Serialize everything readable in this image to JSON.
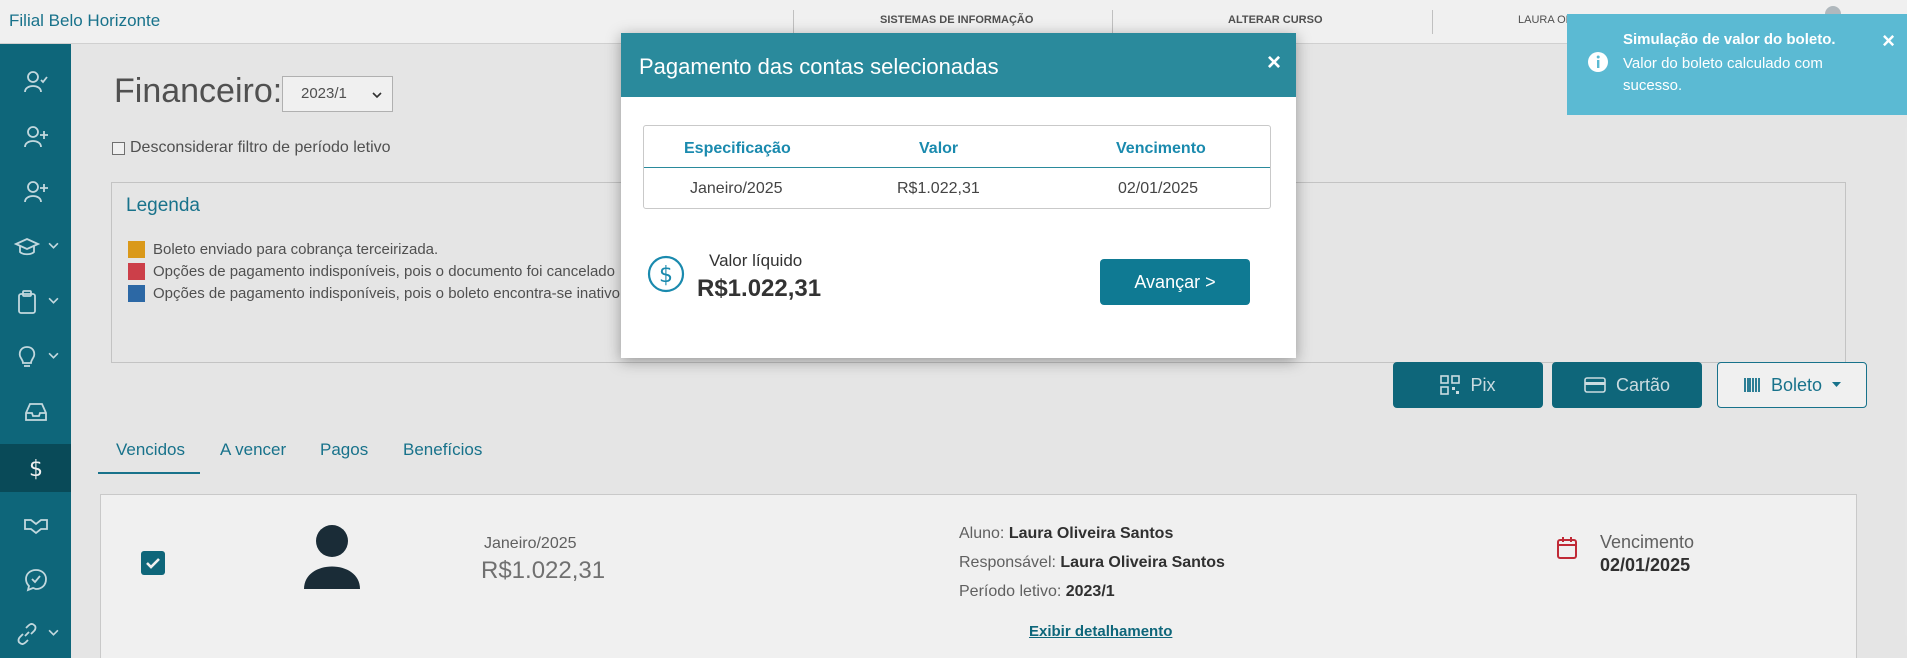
{
  "topbar": {
    "brand": "Filial Belo Horizonte",
    "nav": [
      "SISTEMAS DE INFORMAÇÃO",
      "ALTERAR CURSO"
    ],
    "user": "LAURA OLIVEIRA SANTOS (RA:54443)"
  },
  "sidebar": {
    "items": [
      {
        "icon": "user-check-icon",
        "has_chevron": false
      },
      {
        "icon": "user-plus-icon",
        "has_chevron": false
      },
      {
        "icon": "user-add-icon",
        "has_chevron": false
      },
      {
        "icon": "graduation-cap-icon",
        "has_chevron": true
      },
      {
        "icon": "clipboard-icon",
        "has_chevron": true
      },
      {
        "icon": "lightbulb-icon",
        "has_chevron": true
      },
      {
        "icon": "inbox-icon",
        "has_chevron": false
      },
      {
        "icon": "dollar-icon",
        "has_chevron": false,
        "active": true
      },
      {
        "icon": "handshake-icon",
        "has_chevron": false
      },
      {
        "icon": "chat-check-icon",
        "has_chevron": false
      },
      {
        "icon": "link-icon",
        "has_chevron": true
      }
    ]
  },
  "main": {
    "title": "Financeiro:",
    "period": "2023/1",
    "ignore_filter_label": "Desconsiderar filtro de período letivo",
    "legend": {
      "title": "Legenda",
      "items": [
        {
          "color": "#e8a31c",
          "text": "Boleto enviado para cobrança terceirizada."
        },
        {
          "color": "#d9434e",
          "text": "Opções de pagamento indisponíveis, pois o documento foi cancelado"
        },
        {
          "color": "#2f6fb0",
          "text": "Opções de pagamento indisponíveis, pois o boleto encontra-se inativo"
        }
      ]
    },
    "pay_buttons": {
      "pix": "Pix",
      "card": "Cartão",
      "boleto": "Boleto"
    },
    "tabs": [
      "Vencidos",
      "A vencer",
      "Pagos",
      "Benefícios"
    ],
    "card": {
      "month": "Janeiro/2025",
      "amount": "R$1.022,31",
      "student_label": "Aluno:",
      "student": "Laura Oliveira Santos",
      "responsible_label": "Responsável:",
      "responsible": "Laura Oliveira Santos",
      "period_label": "Período letivo:",
      "period": "2023/1",
      "details_link": "Exibir detalhamento",
      "due_label": "Vencimento",
      "due_value": "02/01/2025"
    }
  },
  "modal": {
    "title": "Pagamento das contas selecionadas",
    "close": "×",
    "columns": [
      "Especificação",
      "Valor",
      "Vencimento"
    ],
    "row": [
      "Janeiro/2025",
      "R$1.022,31",
      "02/01/2025"
    ],
    "net_label": "Valor líquido",
    "net_value": "R$1.022,31",
    "advance": "Avançar >"
  },
  "toast": {
    "title": "Simulação de valor do boleto.",
    "message": "Valor do boleto calculado com sucesso.",
    "close": "×"
  }
}
